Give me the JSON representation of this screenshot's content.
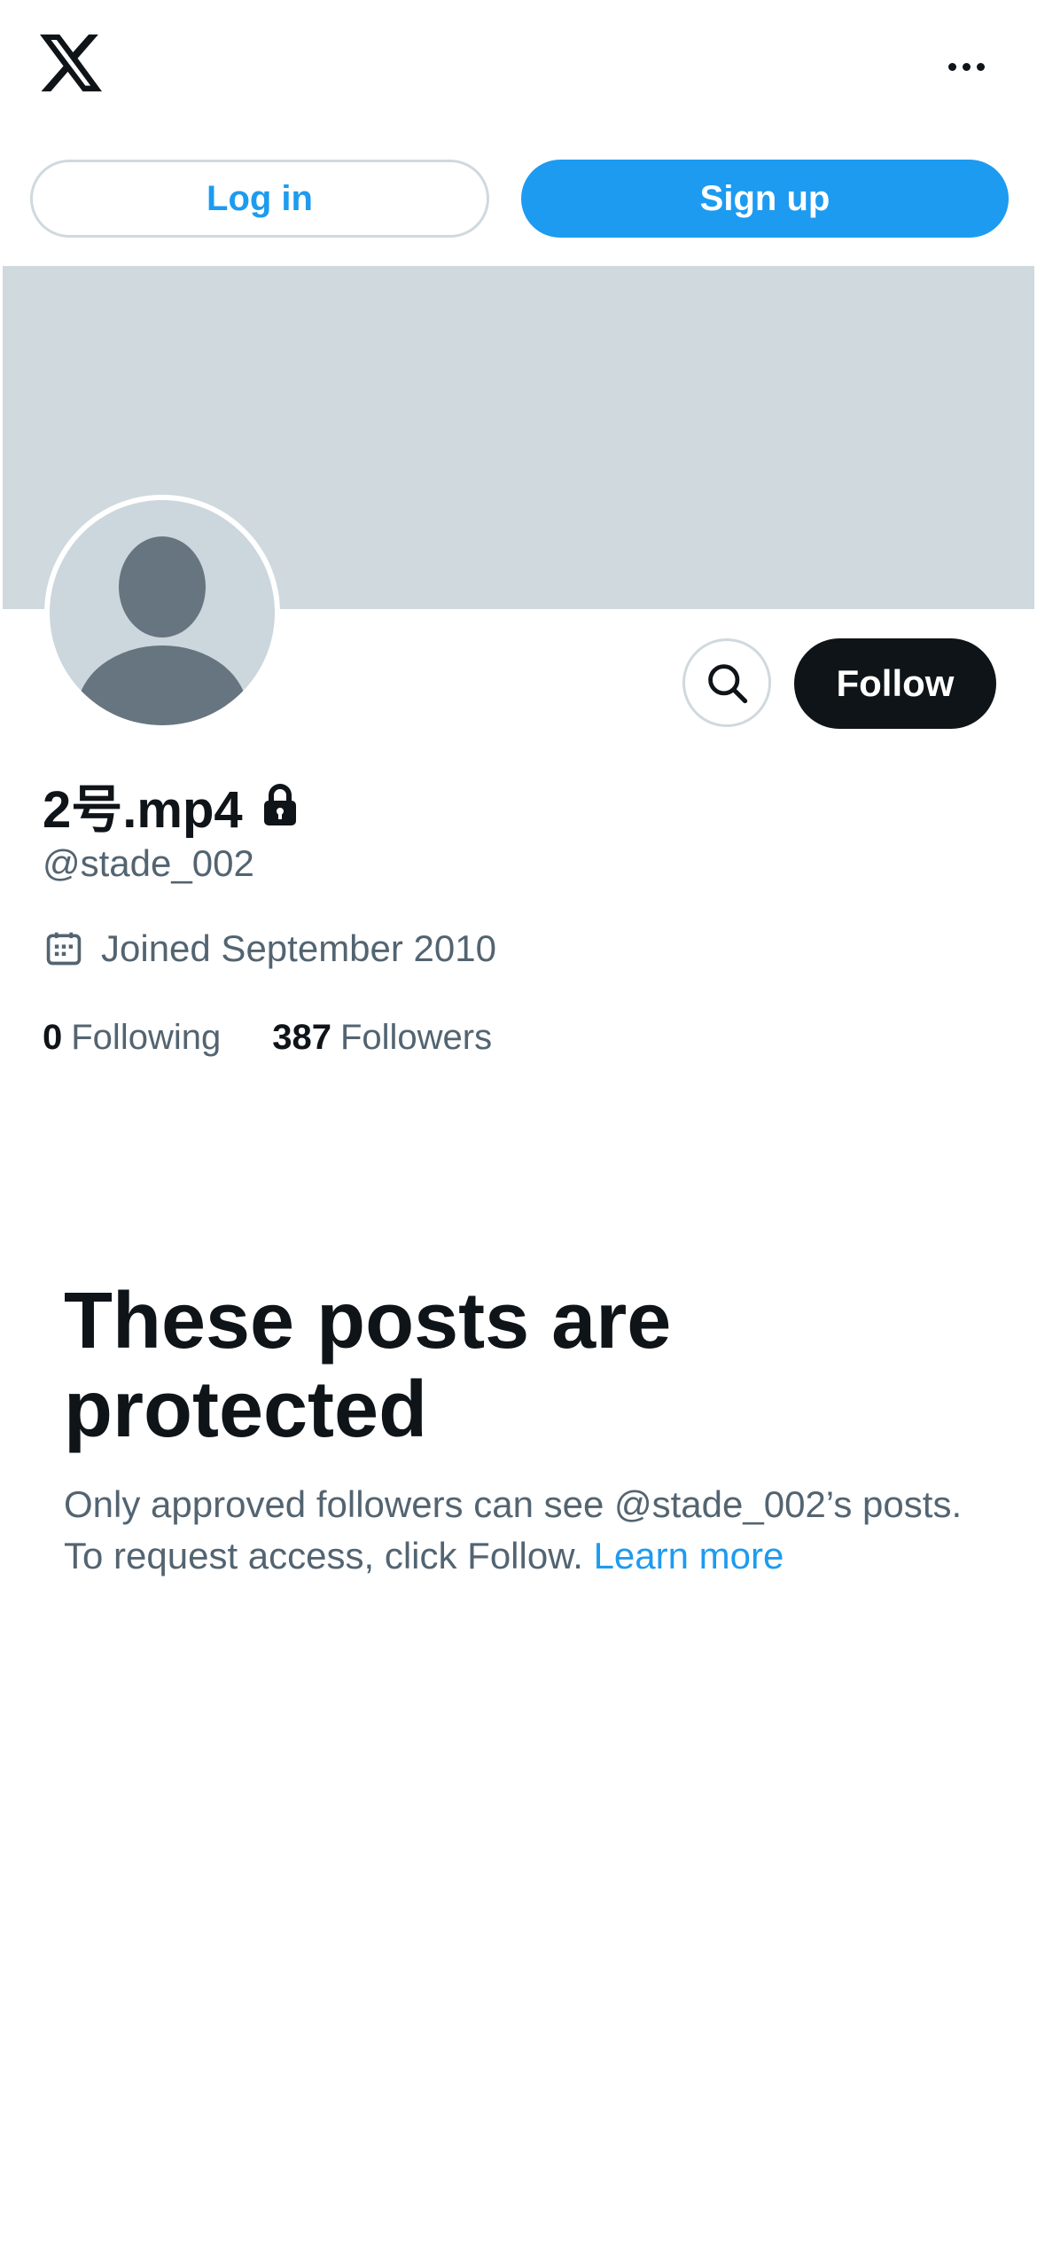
{
  "header": {
    "logo_icon": "x-logo-icon",
    "more_icon": "more-horizontal-icon"
  },
  "auth": {
    "login_label": "Log in",
    "signup_label": "Sign up"
  },
  "profile": {
    "display_name": "2号.mp4",
    "handle": "@stade_002",
    "joined": "Joined September 2010",
    "following_count": "0",
    "following_label": "Following",
    "followers_count": "387",
    "followers_label": "Followers",
    "follow_label": "Follow"
  },
  "protected": {
    "title": "These posts are protected",
    "body": "Only approved followers can see @stade_002’s posts. To request access, click Follow.",
    "learn_more": "Learn more"
  },
  "colors": {
    "accent": "#1d9bf0",
    "text_primary": "#0f1419",
    "text_secondary": "#536471",
    "banner": "#cfd9de"
  }
}
